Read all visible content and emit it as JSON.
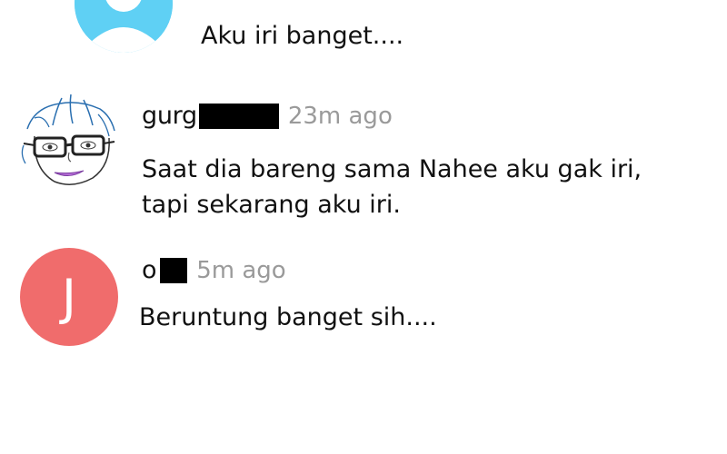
{
  "comments": [
    {
      "avatar_icon": "default-user-icon",
      "avatar_color": "#5fd0f4",
      "text": "Aku iri banget...."
    },
    {
      "avatar_icon": "cartoon-face-with-glasses-icon",
      "username": "gurg",
      "time": "23m ago",
      "text_lines": [
        "Saat dia bareng sama Nahee aku gak iri,",
        "tapi sekarang aku iri."
      ]
    },
    {
      "avatar_initial": "J",
      "avatar_color": "#f06c6c",
      "username": "o",
      "time": "5m ago",
      "text": "Beruntung banget sih...."
    }
  ],
  "colors": {
    "time_text": "#9a9a9a",
    "body_text": "#111111"
  }
}
